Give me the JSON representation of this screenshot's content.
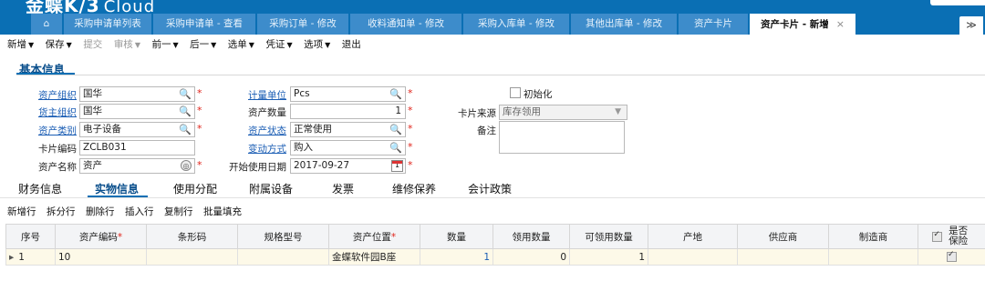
{
  "app": {
    "brand": "金蝶K/3",
    "brand_sub": "Cloud"
  },
  "tabs": [
    {
      "label": "⌂"
    },
    {
      "label": "采购申请单列表"
    },
    {
      "label": "采购申请单 - 查看"
    },
    {
      "label": "采购订单 - 修改"
    },
    {
      "label": "收料通知单 - 修改"
    },
    {
      "label": "采购入库单 - 修改"
    },
    {
      "label": "其他出库单 - 修改"
    },
    {
      "label": "资产卡片"
    },
    {
      "label": "资产卡片 - 新增",
      "close": "×"
    }
  ],
  "tab_more": "≫",
  "toolbar": [
    {
      "label": "新增",
      "caret": "▼"
    },
    {
      "label": "保存",
      "caret": "▼"
    },
    {
      "label": "提交",
      "caret": ""
    },
    {
      "label": "审核",
      "caret": "▼"
    },
    {
      "label": "前一",
      "caret": "▼"
    },
    {
      "label": "后一",
      "caret": "▼"
    },
    {
      "label": "选单",
      "caret": "▼"
    },
    {
      "label": "凭证",
      "caret": "▼"
    },
    {
      "label": "选项",
      "caret": "▼"
    },
    {
      "label": "退出",
      "caret": ""
    }
  ],
  "section_title": "基本信息",
  "form": {
    "asset_org": {
      "label": "资产组织",
      "value": "国华"
    },
    "owner_org": {
      "label": "货主组织",
      "value": "国华"
    },
    "asset_category": {
      "label": "资产类别",
      "value": "电子设备"
    },
    "card_code": {
      "label": "卡片编码",
      "value": "ZCLB031"
    },
    "asset_name": {
      "label": "资产名称",
      "value": "资产"
    },
    "unit": {
      "label": "计量单位",
      "value": "Pcs"
    },
    "asset_qty": {
      "label": "资产数量",
      "value": "1"
    },
    "asset_status": {
      "label": "资产状态",
      "value": "正常使用"
    },
    "change_method": {
      "label": "变动方式",
      "value": "购入"
    },
    "start_date": {
      "label": "开始使用日期",
      "value": "2017-09-27",
      "cal_day": "1"
    },
    "initialize": {
      "label": "初始化"
    },
    "card_source": {
      "label": "卡片来源",
      "value": "库存领用"
    },
    "remark": {
      "label": "备注",
      "value": ""
    }
  },
  "icons": {
    "search": "🔍",
    "caret_down": "▼",
    "camera": "◎",
    "star": "*"
  },
  "subtabs": [
    {
      "label": "财务信息"
    },
    {
      "label": "实物信息"
    },
    {
      "label": "使用分配"
    },
    {
      "label": "附属设备"
    },
    {
      "label": "发票"
    },
    {
      "label": "维修保养"
    },
    {
      "label": "会计政策"
    }
  ],
  "grid_toolbar": [
    "新增行",
    "拆分行",
    "删除行",
    "插入行",
    "复制行",
    "批量填充"
  ],
  "grid": {
    "columns": [
      "序号",
      "资产编码",
      "条形码",
      "规格型号",
      "资产位置",
      "数量",
      "领用数量",
      "可领用数量",
      "产地",
      "供应商",
      "制造商",
      "是否保险"
    ],
    "row": {
      "arrow": "▸",
      "seq": "1",
      "asset_code": "10",
      "barcode": "",
      "spec": "",
      "location": "金蝶软件园B座",
      "qty": "1",
      "used_qty": "0",
      "available_qty": "1",
      "origin": "",
      "supplier": "",
      "manufacturer": ""
    }
  },
  "colors": {
    "brand_blue": "#0a6fb4",
    "tab_blue": "#3d8ccb",
    "required": "#e0241b",
    "link": "#1a5db4",
    "row_bg": "#fdf9e8"
  }
}
